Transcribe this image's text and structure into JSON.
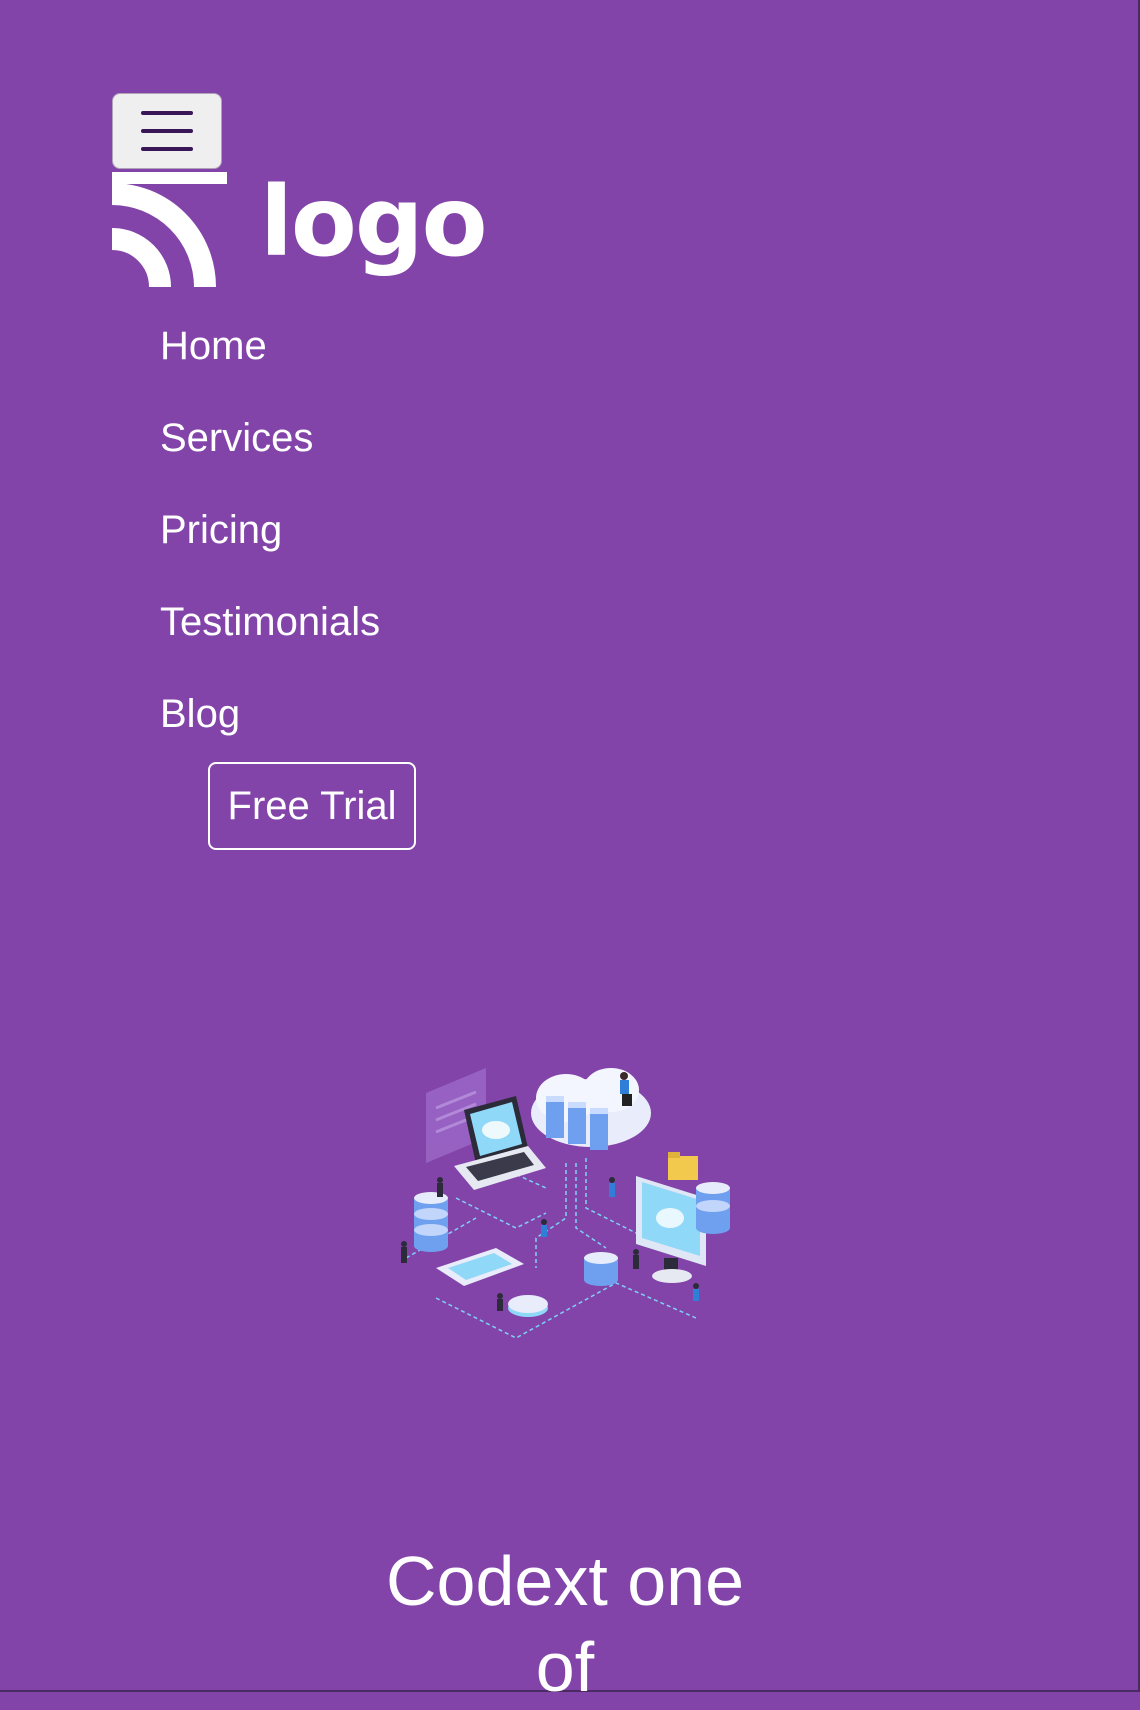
{
  "header": {
    "toggler_label": "Toggle navigation",
    "logo_text": "logo"
  },
  "nav": {
    "items": [
      {
        "label": "Home"
      },
      {
        "label": "Services"
      },
      {
        "label": "Pricing"
      },
      {
        "label": "Testimonials"
      },
      {
        "label": "Blog"
      }
    ],
    "cta_label": "Free Trial"
  },
  "hero": {
    "title_line1": "Codext one",
    "title_line2": "of"
  },
  "colors": {
    "background": "#8344aa",
    "text": "#ffffff",
    "toggler_icon": "#3a1656"
  }
}
